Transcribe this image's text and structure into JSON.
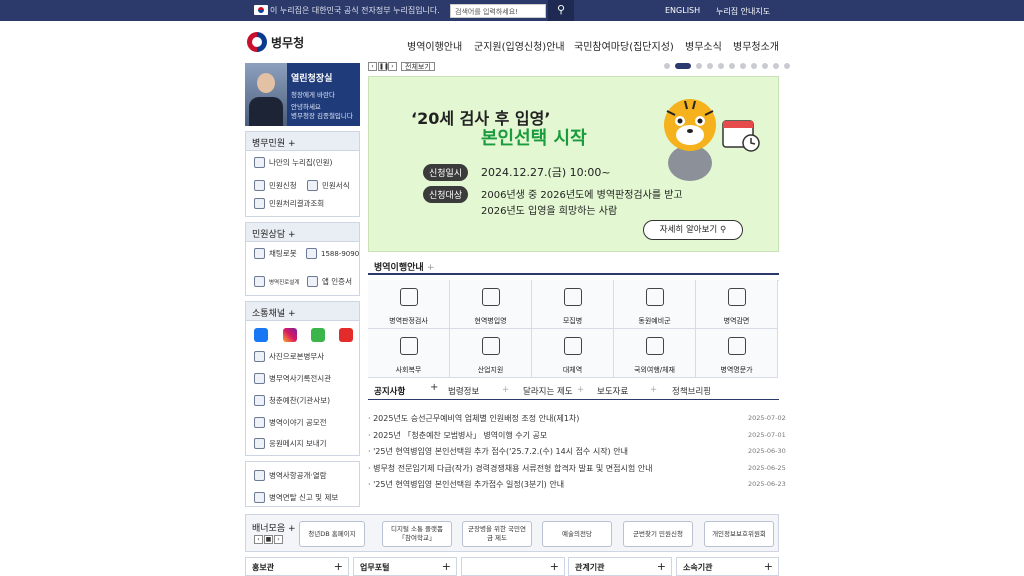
{
  "topbar": {
    "gov_notice": "이 누리집은 대한민국 공식 전자정부 누리집입니다.",
    "search_placeholder": "검색어를 입력하세요!",
    "english": "ENGLISH",
    "sitemap": "누리집 안내지도"
  },
  "logo": "병무청",
  "gnb": [
    "병역이행안내",
    "군지원(입영신청)안내",
    "국민참여마당(집단지성)",
    "병무소식",
    "병무청소개"
  ],
  "ceo": {
    "title": "열린청장실",
    "line1": "청장에게 바란다",
    "line2": "안녕하세요",
    "line3": "병무청장 김종철입니다"
  },
  "sidebar": {
    "civil_title": "병무민원",
    "civil_items": [
      "나만의 누리집(민원)",
      "민원신청",
      "민원서식",
      "민원처리결과조회"
    ],
    "consult_title": "민원상담",
    "consult_items": [
      "채팅로봇",
      "1588-9090",
      "병역진로설계",
      "앱 인증서"
    ],
    "channel_title": "소통채널",
    "channel_items": [
      "사진으로본병무사",
      "병무역사기록전시관",
      "청춘예찬(기관사보)",
      "병역이야기 공모전",
      "응원메시지 보내기"
    ],
    "extra_items": [
      "병역사항공개·열람",
      "병역면탈 신고 및 제보"
    ]
  },
  "slider": {
    "all_label": "전체보기",
    "total_slides": 11,
    "active_slide": 2
  },
  "banner": {
    "headline": "‘20세 검사 후 입영’",
    "subhead": "본인선택 시작",
    "date_label": "신청일시",
    "date_value": "2024.12.27.(금) 10:00~",
    "target_label": "신청대상",
    "target_line1": "2006년생 중 2026년도에 병역판정검사를 받고",
    "target_line2": "2026년도 입영을 희망하는 사람",
    "more": "자세히 알아보기"
  },
  "guide": {
    "title": "병역이행안내",
    "items": [
      "병역판정검사",
      "현역병입영",
      "모집병",
      "동원예비군",
      "병역감면",
      "사회복무",
      "산업지원",
      "대체역",
      "국외여행/체재",
      "병역명문가"
    ]
  },
  "tabs": [
    "공지사항",
    "법령정보",
    "달라지는 제도",
    "보도자료",
    "정책브리핑"
  ],
  "notices": [
    {
      "title": "2025년도 승선근무예비역 업체별 인원배정 조정 안내(제1차)",
      "date": "2025-07-02"
    },
    {
      "title": "2025년 「청춘예찬 모범병사」 병역이행 수기 공모",
      "date": "2025-07-01"
    },
    {
      "title": "'25년 현역병입영 본인선택원 추가 접수('25.7.2.(수) 14시 접수 시작) 안내",
      "date": "2025-06-30"
    },
    {
      "title": "병무청 전문임기제 다급(작가) 경력경쟁채용 서류전형 합격자 발표 및 면접시험 안내",
      "date": "2025-06-25"
    },
    {
      "title": "'25년 현역병입영 본인선택원 추가접수 일정(3분기) 안내",
      "date": "2025-06-23"
    }
  ],
  "banner_zone": {
    "title": "배너모음",
    "items": [
      "청년DB 홈페이지",
      "디지털 소통 플랫폼 「참여학교」",
      "군장병을 위한 국민연금 제도",
      "예술의전당",
      "군번찾기 민원신청",
      "개인정보보호위원회"
    ]
  },
  "footer_links": [
    "홍보관",
    "업무포털",
    "",
    "관계기관",
    "소속기관"
  ]
}
